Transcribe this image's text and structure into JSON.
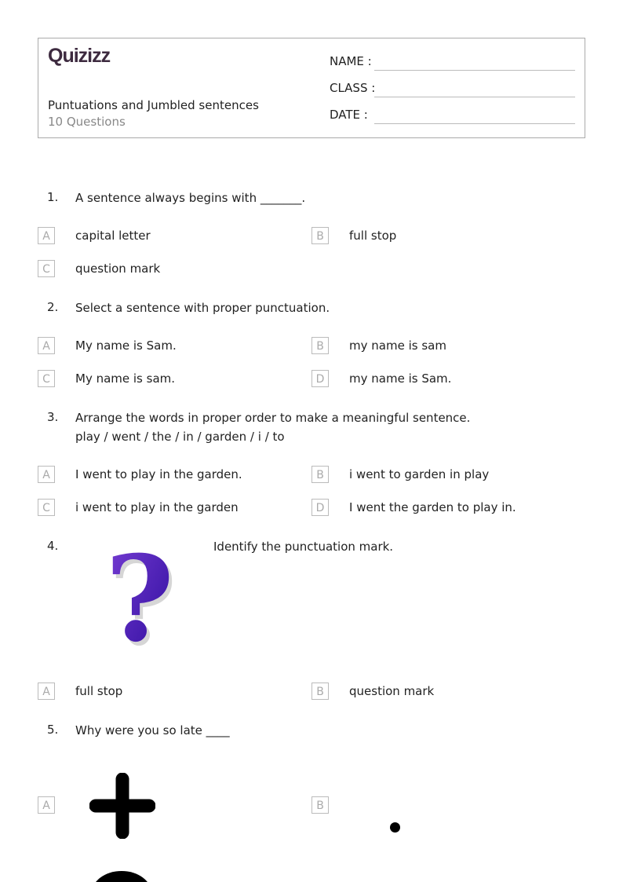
{
  "header": {
    "logo": "Quizizz",
    "title": "Puntuations and Jumbled sentences",
    "subtitle": "10 Questions",
    "name_label": "NAME :",
    "class_label": "CLASS :",
    "date_label": "DATE  :"
  },
  "questions": [
    {
      "num": "1.",
      "text": "A sentence always begins with _______.",
      "options": [
        {
          "letter": "A",
          "text": "capital letter"
        },
        {
          "letter": "B",
          "text": "full stop"
        },
        {
          "letter": "C",
          "text": "question mark"
        }
      ]
    },
    {
      "num": "2.",
      "text": "Select a sentence with proper punctuation.",
      "options": [
        {
          "letter": "A",
          "text": "My name is Sam."
        },
        {
          "letter": "B",
          "text": "my name is sam"
        },
        {
          "letter": "C",
          "text": "My name is sam."
        },
        {
          "letter": "D",
          "text": "my name is Sam."
        }
      ]
    },
    {
      "num": "3.",
      "text": "Arrange the words in proper order to make a meaningful sentence.",
      "text2": "play / went / the / in / garden / i / to",
      "options": [
        {
          "letter": "A",
          "text": "I went to play in the garden."
        },
        {
          "letter": "B",
          "text": "i went to garden in play"
        },
        {
          "letter": "C",
          "text": "i went to play in the garden"
        },
        {
          "letter": "D",
          "text": "I went the garden to play in."
        }
      ]
    },
    {
      "num": "4.",
      "text": "Identify the punctuation mark.",
      "image": "question-mark-3d",
      "options": [
        {
          "letter": "A",
          "text": "full stop"
        },
        {
          "letter": "B",
          "text": "question mark"
        }
      ]
    },
    {
      "num": "5.",
      "text": "Why were you so late ____",
      "options": [
        {
          "letter": "A",
          "image": "plus-sign"
        },
        {
          "letter": "B",
          "image": "full-stop-dot"
        }
      ]
    }
  ]
}
